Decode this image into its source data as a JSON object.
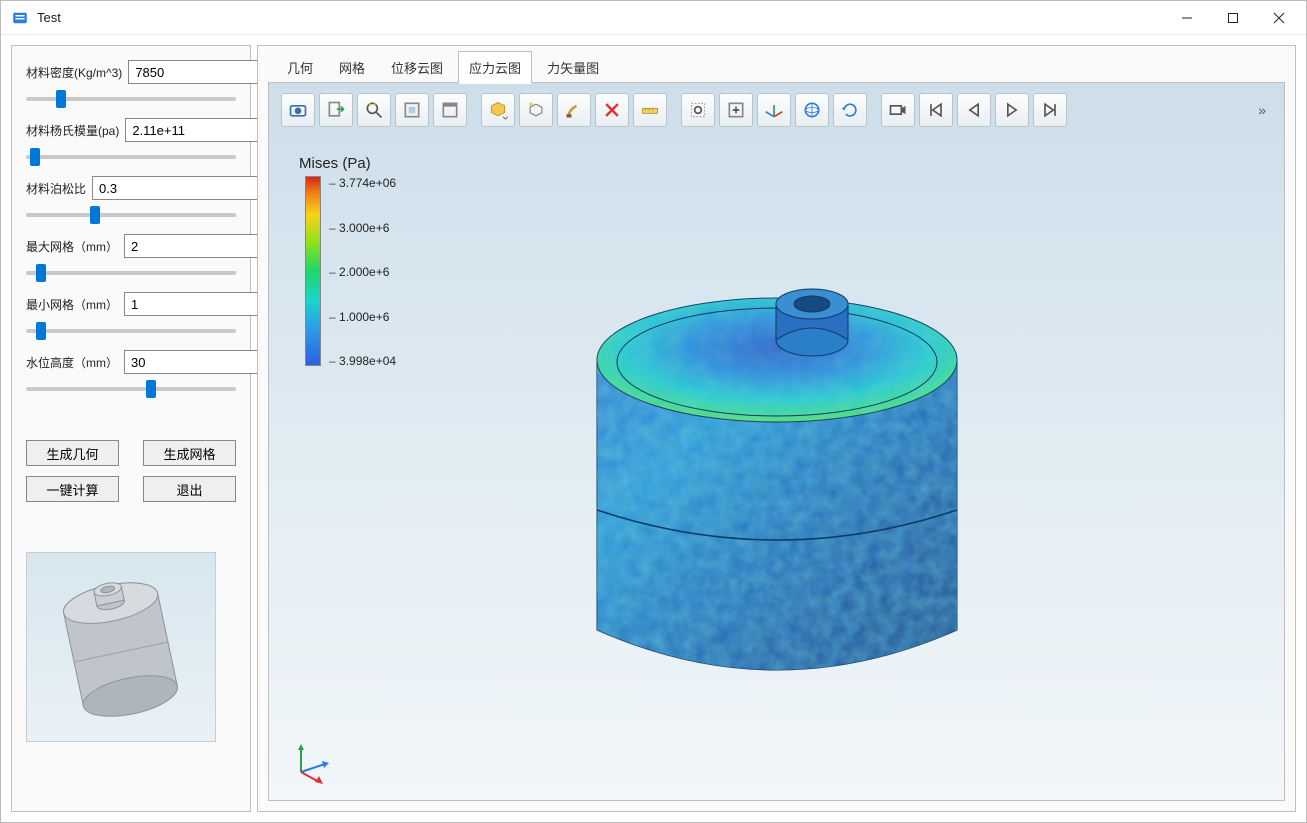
{
  "window": {
    "title": "Test"
  },
  "params": {
    "density": {
      "label": "材料密度(Kg/m^3)",
      "value": "7850",
      "slider": 15
    },
    "youngs": {
      "label": "材料杨氏模量(pa)",
      "value": "2.11e+11",
      "slider": 2
    },
    "poisson": {
      "label": "材料泊松比",
      "value": "0.3",
      "slider": 32
    },
    "maxmesh": {
      "label": "最大网格（mm）",
      "value": "2",
      "slider": 5
    },
    "minmesh": {
      "label": "最小网格（mm）",
      "value": "1",
      "slider": 5
    },
    "water": {
      "label": "水位高度（mm）",
      "value": "30",
      "slider": 60
    }
  },
  "buttons": {
    "geom": "生成几何",
    "mesh": "生成网格",
    "calc": "一键计算",
    "exit": "退出"
  },
  "tabs": {
    "t0": "几何",
    "t1": "网格",
    "t2": "位移云图",
    "t3": "应力云图",
    "t4": "力矢量图",
    "active": "t3"
  },
  "legend": {
    "title": "Mises (Pa)",
    "ticks": [
      "3.774e+06",
      "3.000e+6",
      "2.000e+6",
      "1.000e+6",
      "3.998e+04"
    ]
  },
  "toolbar_icons": [
    "camera-icon",
    "export-icon",
    "zoom-icon",
    "select-box-icon",
    "window-icon",
    "cube-dropdown-icon",
    "cube-light-icon",
    "brush-icon",
    "delete-x-icon",
    "ruler-icon",
    "zoom-area-icon",
    "fit-icon",
    "axis-icon",
    "globe-icon",
    "rotate-icon",
    "video-icon",
    "skip-start-icon",
    "play-prev-icon",
    "play-next-icon",
    "skip-end-icon"
  ],
  "colors": {
    "accent": "#0078d7"
  }
}
